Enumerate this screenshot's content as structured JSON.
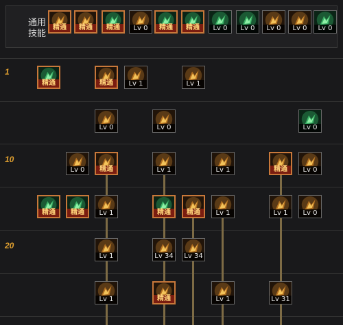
{
  "common_skills": {
    "label_line1": "通用",
    "label_line2": "技能",
    "items": [
      {
        "id": "c1",
        "icon": "sitting-figure-icon",
        "tint": "gold",
        "badge": "精通",
        "mastered": true
      },
      {
        "id": "c2",
        "icon": "kick-figure-icon",
        "tint": "gold",
        "badge": "精通",
        "mastered": true
      },
      {
        "id": "c3",
        "icon": "running-figure-icon",
        "tint": "green",
        "badge": "精通",
        "mastered": true
      },
      {
        "id": "c4",
        "icon": "winged-crest-icon",
        "tint": "gold",
        "badge": "Lv 0",
        "mastered": false
      },
      {
        "id": "c5",
        "icon": "crosshair-icon",
        "tint": "green",
        "badge": "精通",
        "mastered": true
      },
      {
        "id": "c6",
        "icon": "crosshair-burst-icon",
        "tint": "green",
        "badge": "精通",
        "mastered": true
      },
      {
        "id": "c7",
        "icon": "sprinting-figure-icon",
        "tint": "green",
        "badge": "Lv 0",
        "mastered": false
      },
      {
        "id": "c8",
        "icon": "sparkle-figure-icon",
        "tint": "green",
        "badge": "Lv 0",
        "mastered": false
      },
      {
        "id": "c9",
        "icon": "eye-ring-icon",
        "tint": "gold",
        "badge": "Lv 0",
        "mastered": false
      },
      {
        "id": "c10",
        "icon": "muscle-figure-icon",
        "tint": "gold",
        "badge": "Lv 0",
        "mastered": false
      },
      {
        "id": "c11",
        "icon": "staff-figure-icon",
        "tint": "green",
        "badge": "Lv 0",
        "mastered": false
      }
    ]
  },
  "rows": [
    {
      "level": "1",
      "skills": [
        {
          "id": "r1a",
          "icon": "mix-potion-icon",
          "tint": "green",
          "badge": "精通",
          "mastered": true
        },
        {
          "id": "r1b",
          "icon": "swirl-kick-icon",
          "tint": "gold",
          "badge": "精通",
          "mastered": true
        },
        {
          "id": "r1c",
          "icon": "claw-slash-icon",
          "tint": "gold",
          "badge": "Lv 1",
          "mastered": false
        },
        {
          "id": "r1d",
          "icon": "boot-icon",
          "tint": "gold",
          "badge": "Lv 1",
          "mastered": false
        }
      ]
    },
    {
      "level": "",
      "skills": [
        {
          "id": "r2a",
          "icon": "gear-icon",
          "tint": "gold",
          "badge": "Lv 0",
          "mastered": false
        },
        {
          "id": "r2b",
          "icon": "scroll-banner-icon",
          "tint": "gold",
          "badge": "Lv 0",
          "mastered": false
        },
        {
          "id": "r2c",
          "icon": "shield-green-icon",
          "tint": "green",
          "badge": "Lv 0",
          "mastered": false
        }
      ]
    },
    {
      "level": "10",
      "skills": [
        {
          "id": "r3a",
          "icon": "flame-hand-icon",
          "tint": "gold",
          "badge": "Lv 0",
          "mastered": false
        },
        {
          "id": "r3b",
          "icon": "demon-face-icon",
          "tint": "gold",
          "badge": "精通",
          "mastered": true
        },
        {
          "id": "r3c",
          "icon": "shield-icon",
          "tint": "gold",
          "badge": "Lv 1",
          "mastered": false
        },
        {
          "id": "r3d",
          "icon": "light-burst-icon",
          "tint": "gold",
          "badge": "Lv 1",
          "mastered": false
        },
        {
          "id": "r3e",
          "icon": "beast-face-icon",
          "tint": "gold",
          "badge": "精通",
          "mastered": true
        },
        {
          "id": "r3f",
          "icon": "flying-kick-icon",
          "tint": "gold",
          "badge": "Lv 0",
          "mastered": false
        }
      ]
    },
    {
      "level": "",
      "skills": [
        {
          "id": "r4a",
          "icon": "green-eye-icon",
          "tint": "green",
          "badge": "精通",
          "mastered": true
        },
        {
          "id": "r4b",
          "icon": "green-spikes-icon",
          "tint": "green",
          "badge": "精通",
          "mastered": true
        },
        {
          "id": "r4c",
          "icon": "slash-strike-icon",
          "tint": "gold",
          "badge": "Lv 1",
          "mastered": false
        },
        {
          "id": "r4d",
          "icon": "green-runner-icon",
          "tint": "green",
          "badge": "精通",
          "mastered": true
        },
        {
          "id": "r4e",
          "icon": "cross-blades-icon",
          "tint": "gold",
          "badge": "精通",
          "mastered": true
        },
        {
          "id": "r4f",
          "icon": "explosion-icon",
          "tint": "gold",
          "badge": "Lv 1",
          "mastered": false
        },
        {
          "id": "r4g",
          "icon": "warrior-icon",
          "tint": "gold",
          "badge": "Lv 1",
          "mastered": false
        },
        {
          "id": "r4h",
          "icon": "dual-swords-icon",
          "tint": "gold",
          "badge": "Lv 0",
          "mastered": false
        }
      ]
    },
    {
      "level": "20",
      "skills": [
        {
          "id": "r5a",
          "icon": "hammer-icon",
          "tint": "gold",
          "badge": "Lv 1",
          "mastered": false
        },
        {
          "id": "r5b",
          "icon": "skull-mask-icon",
          "tint": "gold",
          "badge": "Lv 34",
          "mastered": false
        },
        {
          "id": "r5c",
          "icon": "bomb-icon",
          "tint": "gold",
          "badge": "Lv 34",
          "mastered": false
        }
      ]
    },
    {
      "level": "",
      "skills": [
        {
          "id": "r6a",
          "icon": "sword-icon",
          "tint": "gold",
          "badge": "Lv 1",
          "mastered": false
        },
        {
          "id": "r6b",
          "icon": "jaws-icon",
          "tint": "gold",
          "badge": "精通",
          "mastered": true
        },
        {
          "id": "r6c",
          "icon": "whirl-icon",
          "tint": "gold",
          "badge": "Lv 1",
          "mastered": false
        },
        {
          "id": "r6d",
          "icon": "warrior-attack-icon",
          "tint": "gold",
          "badge": "Lv 31",
          "mastered": false
        }
      ]
    }
  ]
}
